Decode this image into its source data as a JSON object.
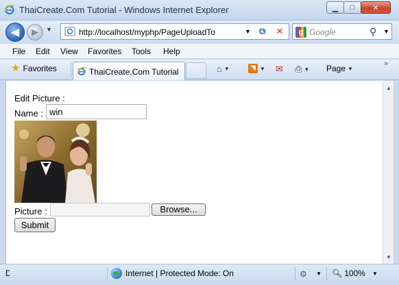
{
  "window": {
    "title": "ThaiCreate.Com Tutorial - Windows Internet Explorer",
    "minimize": "▁",
    "maximize": "□",
    "close": "✕"
  },
  "address_bar": {
    "url": "http://localhost/myphp/PageUploadTo",
    "search_placeholder": "Google"
  },
  "menu": [
    "File",
    "Edit",
    "View",
    "Favorites",
    "Tools",
    "Help"
  ],
  "favorites_bar": {
    "favorites_label": "Favorites",
    "active_tab": "ThaiCreate.Com Tutorial",
    "page_menu": "Page"
  },
  "form": {
    "heading": "Edit Picture :",
    "name_label": "Name :",
    "name_value": "win",
    "picture_label": "Picture :",
    "browse_label": "Browse...",
    "submit_label": "Submit"
  },
  "status_bar": {
    "left_text": "D",
    "zone_text": "Internet | Protected Mode: On",
    "zoom": "100%"
  },
  "icons": {
    "back": "arrow-left-icon",
    "forward": "arrow-right-icon",
    "home": "home-icon",
    "feeds": "rss-icon",
    "mail": "mail-icon",
    "print": "printer-icon",
    "search": "magnifier-icon",
    "zone": "globe-icon"
  },
  "colors": {
    "chrome": "#c9d9ee",
    "close_button": "#c8452c",
    "back_button": "#2a63b8"
  }
}
